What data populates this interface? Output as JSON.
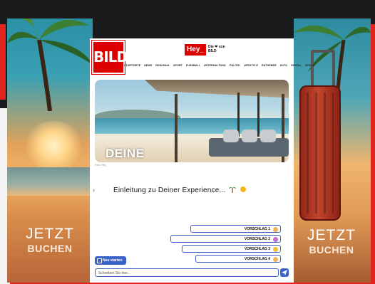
{
  "ad": {
    "cta_left": {
      "line1": "JETZT",
      "line2": "BUCHEN"
    },
    "cta_right": {
      "line1": "JETZT",
      "line2": "BUCHEN"
    }
  },
  "header": {
    "logo_text": "BILD",
    "hey_badge": "Hey_",
    "hey_sub_line1": "Die ❤ von BILD",
    "nav": [
      "STARTSEITE",
      "NEWS",
      "REGIONAL",
      "SPORT",
      "FUSSBALL",
      "UNTERHALTUNG",
      "POLITIK",
      "LIFESTYLE",
      "RATGEBER",
      "AUTO",
      "DIGITAL",
      "SPIELE"
    ]
  },
  "hero": {
    "title": "DEINE",
    "credit": "Foto: Hey_"
  },
  "chat": {
    "intro": "Einleitung zu Deiner Experience...",
    "suggestions": [
      {
        "label": "VORSCHLAG 1",
        "emoji_color": "#f0b35a"
      },
      {
        "label": "VORSCHLAG 2",
        "emoji_color": "#c56bd6"
      },
      {
        "label": "VORSCHLAG 3",
        "emoji_color": "#f2c230"
      },
      {
        "label": "VORSCHLAG 4",
        "emoji_color": "#f0b35a"
      }
    ],
    "new_button": "Neu starten",
    "input_placeholder": "Schreiben Sie hier..."
  },
  "colors": {
    "accent": "#3a62c8",
    "brand": "#dd0000"
  }
}
